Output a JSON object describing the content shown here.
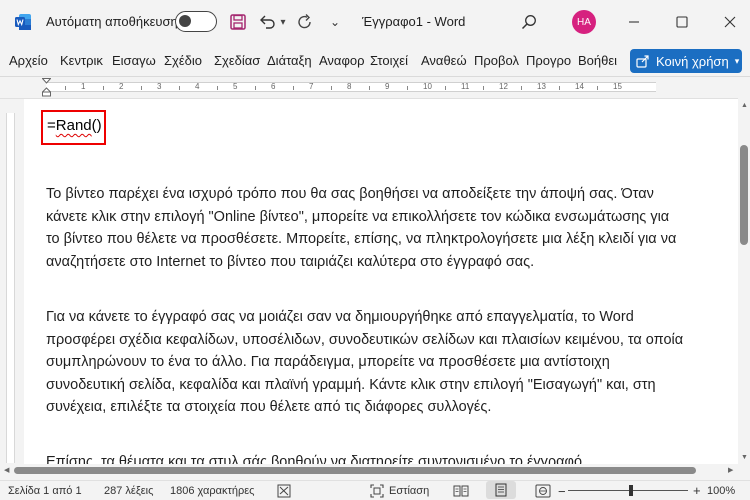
{
  "titlebar": {
    "autosave_label": "Αυτόματη αποθήκευση",
    "document_title": "Έγγραφο1  -  Word",
    "avatar_initials": "HA",
    "dropdown_glyph": "▾",
    "more_glyph": "⌄"
  },
  "ribbon": {
    "tabs": [
      "Αρχείο",
      "Κεντρικ",
      "Εισαγω",
      "Σχέδιο",
      "Σχεδίασ",
      "Διάταξη",
      "Αναφορ",
      "Στοιχεί",
      "Αναθεώ",
      "Προβολ",
      "Προγρο",
      "Βοήθει"
    ],
    "share_label": "Κοινή χρήση"
  },
  "ruler": {
    "numbers": [
      "1",
      "2",
      "3",
      "4",
      "5",
      "6",
      "7",
      "8",
      "9",
      "10",
      "11",
      "12",
      "13",
      "14",
      "15"
    ]
  },
  "document": {
    "formula_prefix": "=",
    "formula_word": "Rand",
    "formula_suffix": "()",
    "paragraph1": "Το βίντεο παρέχει ένα ισχυρό τρόπο που θα σας βοηθήσει να αποδείξετε την άποψή σας. Όταν κάνετε κλικ στην επιλογή \"Online βίντεο\", μπορείτε να επικολλήσετε τον κώδικα ενσωμάτωσης για το βίντεο που θέλετε να προσθέσετε. Μπορείτε, επίσης, να πληκτρολογήσετε μια λέξη κλειδί για να αναζητήσετε στο Internet το βίντεο που ταιριάζει καλύτερα στο έγγραφό σας.",
    "paragraph2": "Για να κάνετε το έγγραφό σας να μοιάζει σαν να δημιουργήθηκε από επαγγελματία, το Word προσφέρει σχέδια κεφαλίδων, υποσέλιδων, συνοδευτικών σελίδων και πλαισίων κειμένου, τα οποία συμπληρώνουν το ένα το άλλο. Για παράδειγμα, μπορείτε να προσθέσετε μια αντίστοιχη συνοδευτική σελίδα, κεφαλίδα και πλαϊνή γραμμή. Κάντε κλικ στην επιλογή \"Εισαγωγή\" και, στη συνέχεια, επιλέξτε τα στοιχεία που θέλετε από τις διάφορες συλλογές.",
    "paragraph3": "Επίσης, τα θέματα και τα στυλ σάς βοηθούν να διατηρείτε συντονισμένο το έγγραφό"
  },
  "statusbar": {
    "page": "Σελίδα 1 από 1",
    "words": "287 λέξεις",
    "characters": "1806 χαρακτήρες",
    "focus": "Εστίαση",
    "zoom_minus": "−",
    "zoom_plus": "+",
    "zoom": "100%"
  },
  "colors": {
    "share_button": "#1b6ec2",
    "avatar": "#d6217f",
    "highlight_box": "#ee0000",
    "save_icon": "#a4266f",
    "word_logo": "#185abd"
  },
  "icons": [
    "word-logo-icon",
    "save-icon",
    "undo-icon",
    "redo-icon",
    "customize-qat-icon",
    "search-icon",
    "minimize-icon",
    "maximize-icon",
    "close-icon",
    "share-icon",
    "proofing-icon",
    "text-predictions-icon",
    "focus-icon",
    "read-mode-icon",
    "print-layout-icon",
    "web-layout-icon"
  ]
}
